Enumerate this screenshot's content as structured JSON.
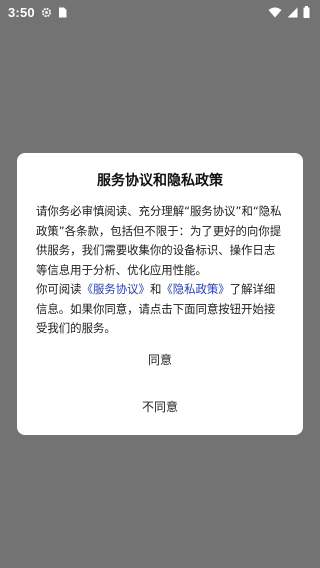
{
  "status_bar": {
    "time": "3:50",
    "icons": [
      "settings-gear-icon",
      "sim-card-icon",
      "wifi-icon",
      "signal-icon",
      "battery-icon"
    ]
  },
  "dialog": {
    "title": "服务协议和隐私政策",
    "body": {
      "para1": "请你务必审慎阅读、充分理解“服务协议”和“隐私政策”各条款，包括但不限于：为了更好的向你提供服务，我们需要收集你的设备标识、操作日志等信息用于分析、优化应用性能。",
      "para2_prefix": "你可阅读",
      "service_link": "《服务协议》",
      "para2_and": "和",
      "privacy_link": "《隐私政策》",
      "para2_suffix": "了解详细信息。如果你同意，请点击下面同意按钮开始接受我们的服务。"
    },
    "agree_label": "同意",
    "disagree_label": "不同意"
  },
  "colors": {
    "overlay": "#737373",
    "dialog_bg": "#ffffff",
    "link": "#2a3fa8"
  }
}
